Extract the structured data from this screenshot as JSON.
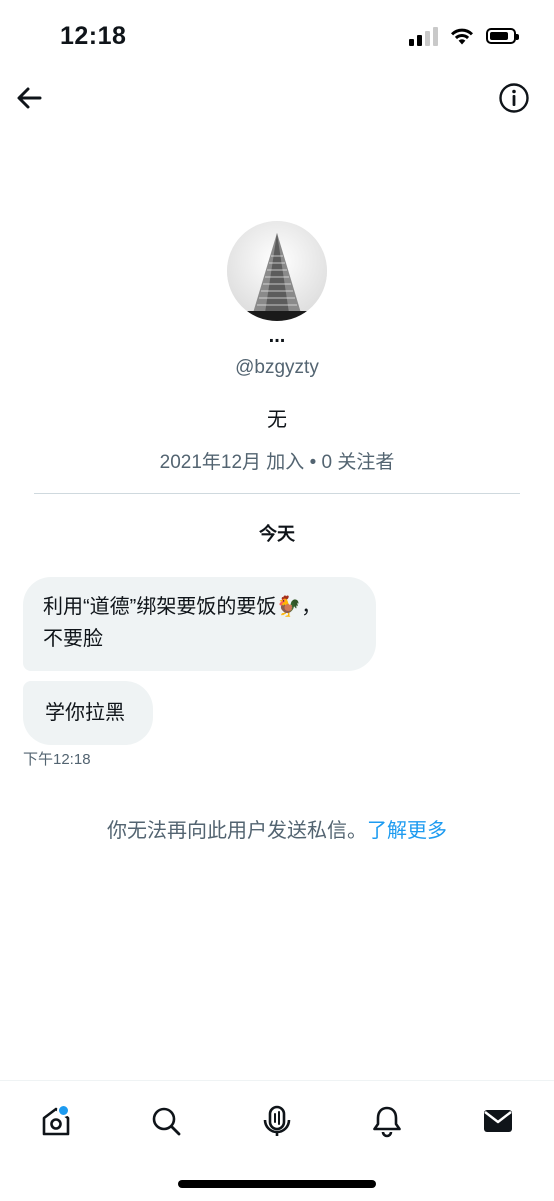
{
  "status_bar": {
    "time": "12:18"
  },
  "header": {
    "back_icon": "arrow-left-icon",
    "info_icon": "info-circle-icon"
  },
  "profile": {
    "display_name": "...",
    "handle": "@bzgyzty",
    "bio": "无",
    "meta": "2021年12月 加入 • 0 关注者"
  },
  "conversation": {
    "date_label": "今天",
    "messages": [
      {
        "text_line1": "利用“道德”绑架要饭的要饭🐓，",
        "text_line2": "不要脸"
      },
      {
        "text": "学你拉黑"
      }
    ],
    "timestamp": "下午12:18"
  },
  "notice": {
    "text": "你无法再向此用户发送私信。",
    "link": "了解更多"
  },
  "tab_bar": {
    "items": [
      "home-icon",
      "search-icon",
      "spaces-icon",
      "notifications-icon",
      "messages-icon"
    ]
  },
  "colors": {
    "accent": "#1d9bf0",
    "secondary_text": "#536471",
    "bubble_bg": "#eff3f4"
  }
}
